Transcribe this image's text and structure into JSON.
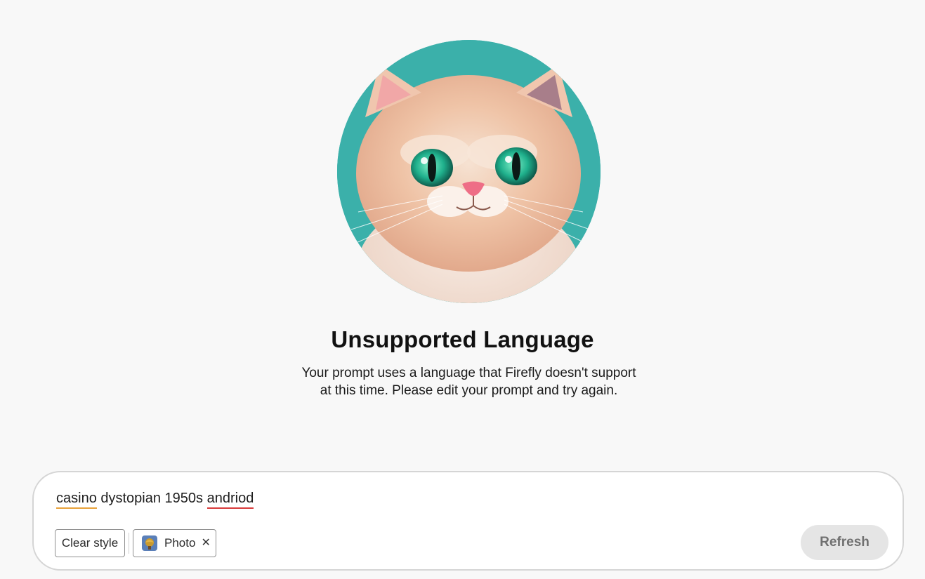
{
  "error": {
    "title": "Unsupported Language",
    "message_line1": "Your prompt uses a language that Firefly doesn't support",
    "message_line2": "at this time. Please edit your prompt and try again."
  },
  "prompt": {
    "words": [
      {
        "text": "casino",
        "flag": "orange"
      },
      {
        "text": " dystopian 1950s ",
        "flag": "none"
      },
      {
        "text": "andriod",
        "flag": "red"
      }
    ]
  },
  "chips": {
    "clear_style_label": "Clear style",
    "photo_label": "Photo",
    "photo_icon": "photo-style-icon",
    "remove_icon": "close-icon"
  },
  "actions": {
    "refresh_label": "Refresh"
  },
  "colors": {
    "background": "#f8f8f8",
    "hero_teal": "#3fb6ae",
    "flag_orange": "#e8a23a",
    "flag_red": "#d83a3a",
    "refresh_bg": "#e5e5e5"
  }
}
